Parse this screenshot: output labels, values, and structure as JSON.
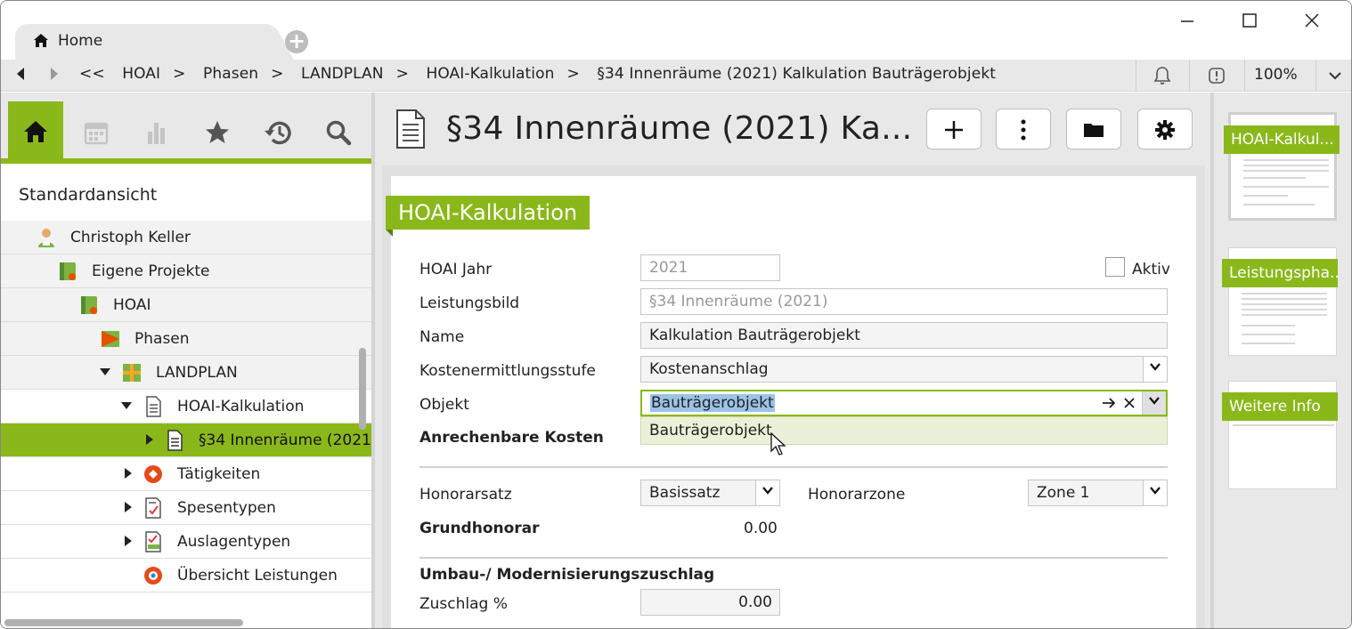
{
  "window": {
    "tab_label": "Home",
    "zoom": "100%"
  },
  "breadcrumb": {
    "back_all": "<<",
    "items": [
      "HOAI",
      "Phasen",
      "LANDPLAN",
      "HOAI-Kalkulation",
      "§34 Innenräume (2021) Kalkulation Bauträgerobjekt"
    ],
    "separator": ">"
  },
  "left_panel": {
    "view_name": "Standardansicht",
    "tree": [
      {
        "label": "Christoph Keller",
        "icon": "user-icon"
      },
      {
        "label": "Eigene Projekte",
        "icon": "project-folder-icon"
      },
      {
        "label": "HOAI",
        "icon": "project-folder-icon"
      },
      {
        "label": "Phasen",
        "icon": "phases-icon"
      },
      {
        "label": "LANDPLAN",
        "icon": "project-grid-icon"
      },
      {
        "label": "HOAI-Kalkulation",
        "icon": "document-icon"
      },
      {
        "label": "§34 Innenräume (2021) Kalkulation Bauträgerobjekt",
        "icon": "document-icon"
      },
      {
        "label": "Tätigkeiten",
        "icon": "activities-icon"
      },
      {
        "label": "Spesentypen",
        "icon": "expense-icon"
      },
      {
        "label": "Auslagentypen",
        "icon": "expense-check-icon"
      },
      {
        "label": "Übersicht Leistungen",
        "icon": "overview-icon"
      }
    ]
  },
  "main": {
    "title": "§34 Innenräume (2021) Ka...",
    "section": "HOAI-Kalkulation",
    "fields": {
      "hoai_jahr_label": "HOAI Jahr",
      "hoai_jahr_value": "2021",
      "aktiv_label": "Aktiv",
      "leistungsbild_label": "Leistungsbild",
      "leistungsbild_value": "§34 Innenräume (2021)",
      "name_label": "Name",
      "name_value": "Kalkulation Bauträgerobjekt",
      "kostenermittlung_label": "Kostenermittlungsstufe",
      "kostenermittlung_value": "Kostenanschlag",
      "objekt_label": "Objekt",
      "objekt_value": "Bauträgerobjekt",
      "objekt_suggestion": "Bauträgerobjekt",
      "anrechenbare_label": "Anrechenbare Kosten",
      "honorarsatz_label": "Honorarsatz",
      "honorarsatz_value": "Basissatz",
      "honorarzone_label": "Honorarzone",
      "honorarzone_value": "Zone 1",
      "grundhonorar_label": "Grundhonorar",
      "grundhonorar_value": "0.00",
      "umbau_label": "Umbau-/ Modernisierungszuschlag",
      "zuschlag_label": "Zuschlag %",
      "zuschlag_value": "0.00"
    }
  },
  "right_panel": {
    "thumbnails": [
      "HOAI-Kalkul...",
      "Leistungspha...",
      "Weitere Info"
    ]
  },
  "colors": {
    "accent": "#8ab81a",
    "panel_bg": "#e8e8e8",
    "selection": "#9cc3e8"
  }
}
